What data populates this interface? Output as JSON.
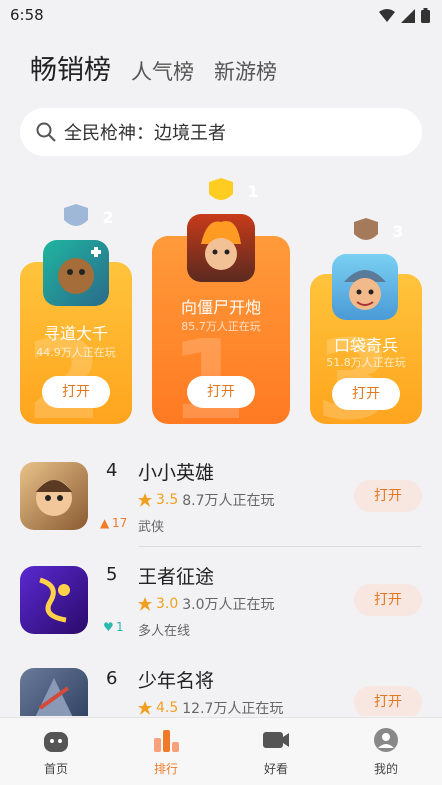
{
  "status": {
    "time": "6:58"
  },
  "tabs": [
    {
      "label": "畅销榜",
      "active": true
    },
    {
      "label": "人气榜",
      "active": false
    },
    {
      "label": "新游榜",
      "active": false
    }
  ],
  "search": {
    "placeholder": "全民枪神：边境王者"
  },
  "podium": [
    {
      "rank": "2",
      "name": "寻道大千",
      "players": "44.9万人正在玩",
      "open": "打开"
    },
    {
      "rank": "1",
      "name": "向僵尸开炮",
      "players": "85.7万人正在玩",
      "open": "打开"
    },
    {
      "rank": "3",
      "name": "口袋奇兵",
      "players": "51.8万人正在玩",
      "open": "打开"
    }
  ],
  "list": [
    {
      "rank": "4",
      "name": "小小英雄",
      "rating": "3.5",
      "players": "8.7万人正在玩",
      "tag": "武侠",
      "trend": "17",
      "trend_dir": "up",
      "open": "打开"
    },
    {
      "rank": "5",
      "name": "王者征途",
      "rating": "3.0",
      "players": "3.0万人正在玩",
      "tag": "多人在线",
      "trend": "1",
      "trend_dir": "down",
      "open": "打开"
    },
    {
      "rank": "6",
      "name": "少年名将",
      "rating": "4.5",
      "players": "12.7万人正在玩",
      "tag": "",
      "trend": "",
      "trend_dir": "",
      "open": "打开"
    }
  ],
  "nav": [
    {
      "label": "首页",
      "icon": "home-icon",
      "active": false
    },
    {
      "label": "排行",
      "icon": "ranking-icon",
      "active": true
    },
    {
      "label": "好看",
      "icon": "video-icon",
      "active": false
    },
    {
      "label": "我的",
      "icon": "profile-icon",
      "active": false
    }
  ],
  "colors": {
    "accent": "#f07a2a",
    "podium_gold": "#ffb02e",
    "podium_first": "#ff8a2e",
    "background": "#f2f2f4"
  }
}
